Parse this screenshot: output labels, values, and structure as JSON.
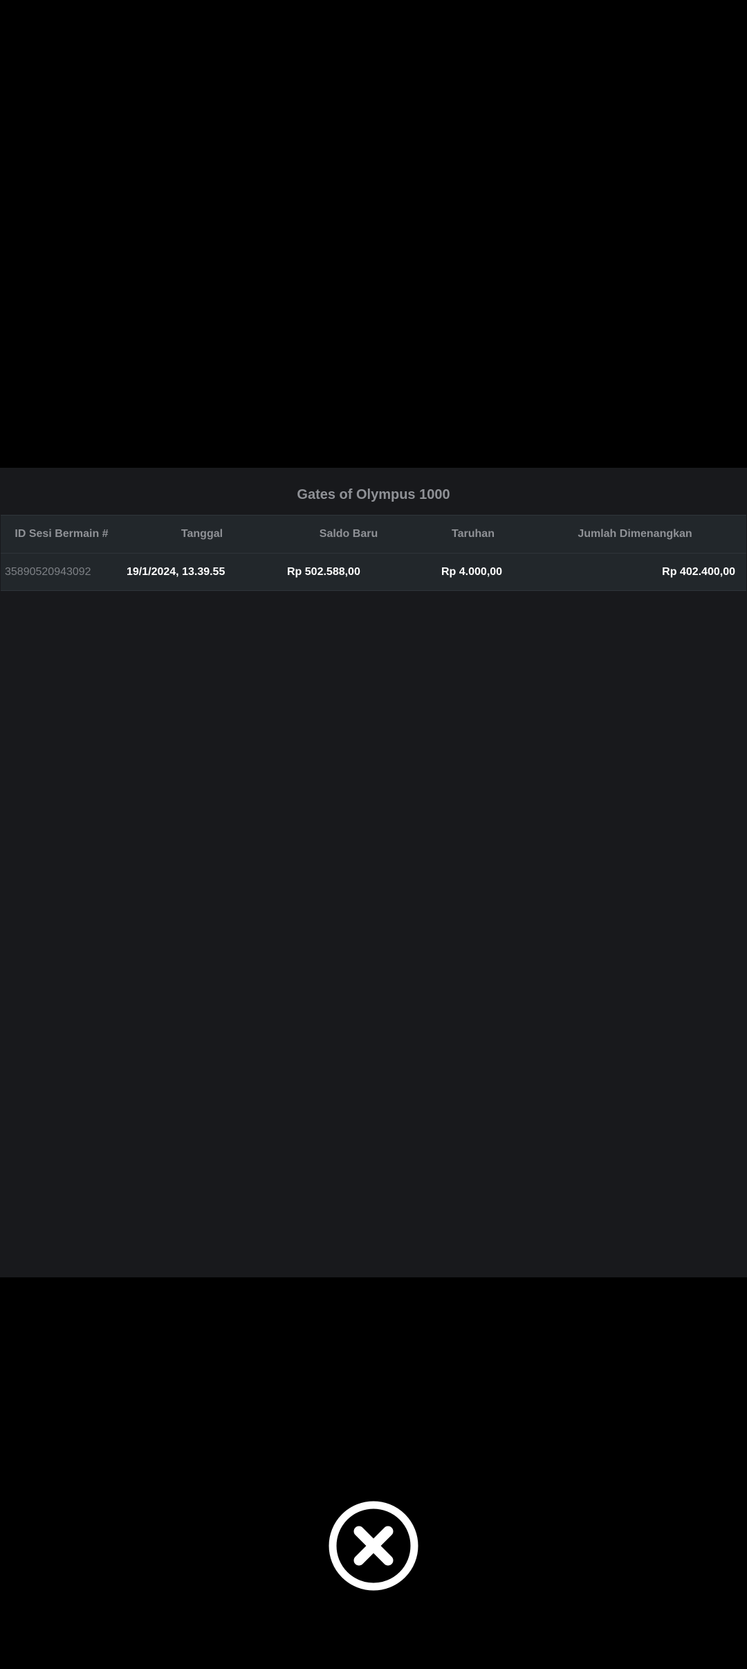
{
  "panel": {
    "title": "Gates of Olympus 1000"
  },
  "table": {
    "columns": [
      "ID Sesi Bermain #",
      "Tanggal",
      "Saldo Baru",
      "Taruhan",
      "Jumlah Dimenangkan"
    ],
    "rows": [
      {
        "id": "35890520943092",
        "date": "19/1/2024, 13.39.55",
        "new_balance": "Rp 502.588,00",
        "bet": "Rp 4.000,00",
        "win": "Rp 402.400,00"
      }
    ]
  },
  "close_button": {
    "icon": "close-circle-icon",
    "color": "#ffffff"
  },
  "colors": {
    "background": "#000000",
    "panel": "#18191c",
    "table_row": "#22272b",
    "muted_text": "#8f9196"
  }
}
